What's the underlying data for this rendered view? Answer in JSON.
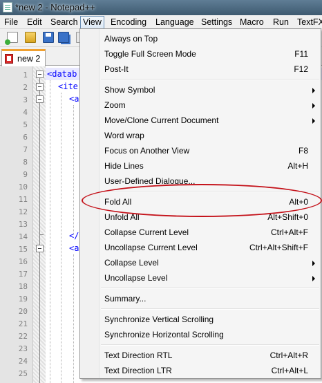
{
  "window": {
    "title": "*new  2 - Notepad++"
  },
  "menubar": {
    "items": [
      "File",
      "Edit",
      "Search",
      "View",
      "Encoding",
      "Language",
      "Settings",
      "Macro",
      "Run",
      "TextFX"
    ]
  },
  "toolbar": {
    "icons": [
      "new-file-icon",
      "open-file-icon",
      "save-icon",
      "save-all-icon",
      "close-icon"
    ]
  },
  "tabs": [
    {
      "label": "new  2"
    }
  ],
  "editor": {
    "line_numbers": [
      "1",
      "2",
      "3",
      "4",
      "5",
      "6",
      "7",
      "8",
      "9",
      "10",
      "11",
      "12",
      "13",
      "14",
      "15",
      "16",
      "17",
      "18",
      "19",
      "20",
      "21",
      "22",
      "23",
      "24",
      "25"
    ],
    "visible_code": [
      "<datab",
      "<ite",
      "<a",
      "</",
      "<a"
    ],
    "current_line": "1"
  },
  "view_menu": {
    "items": [
      {
        "label": "Always on Top",
        "shortcut": "",
        "submenu": false
      },
      {
        "label": "Toggle Full Screen Mode",
        "shortcut": "F11",
        "submenu": false
      },
      {
        "label": "Post-It",
        "shortcut": "F12",
        "submenu": false
      },
      {
        "label": "Show Symbol",
        "shortcut": "",
        "submenu": true
      },
      {
        "label": "Zoom",
        "shortcut": "",
        "submenu": true
      },
      {
        "label": "Move/Clone Current Document",
        "shortcut": "",
        "submenu": true
      },
      {
        "label": "Word wrap",
        "shortcut": "",
        "submenu": false
      },
      {
        "label": "Focus on Another View",
        "shortcut": "F8",
        "submenu": false
      },
      {
        "label": "Hide Lines",
        "shortcut": "Alt+H",
        "submenu": false
      },
      {
        "label": "User-Defined Dialogue...",
        "shortcut": "",
        "submenu": false
      },
      {
        "label": "Fold All",
        "shortcut": "Alt+0",
        "submenu": false
      },
      {
        "label": "Unfold All",
        "shortcut": "Alt+Shift+0",
        "submenu": false
      },
      {
        "label": "Collapse Current Level",
        "shortcut": "Ctrl+Alt+F",
        "submenu": false
      },
      {
        "label": "Uncollapse Current Level",
        "shortcut": "Ctrl+Alt+Shift+F",
        "submenu": false
      },
      {
        "label": "Collapse Level",
        "shortcut": "",
        "submenu": true
      },
      {
        "label": "Uncollapse Level",
        "shortcut": "",
        "submenu": true
      },
      {
        "label": "Summary...",
        "shortcut": "",
        "submenu": false
      },
      {
        "label": "Synchronize Vertical Scrolling",
        "shortcut": "",
        "submenu": false
      },
      {
        "label": "Synchronize Horizontal Scrolling",
        "shortcut": "",
        "submenu": false
      },
      {
        "label": "Text Direction RTL",
        "shortcut": "Ctrl+Alt+R",
        "submenu": false
      },
      {
        "label": "Text Direction LTR",
        "shortcut": "Ctrl+Alt+L",
        "submenu": false
      }
    ],
    "highlighted": "Fold All"
  },
  "colors": {
    "annotation": "#c4121a",
    "tag": "#0000ff",
    "tab_accent": "#f0a030",
    "current_line": "#e8e8ff"
  }
}
